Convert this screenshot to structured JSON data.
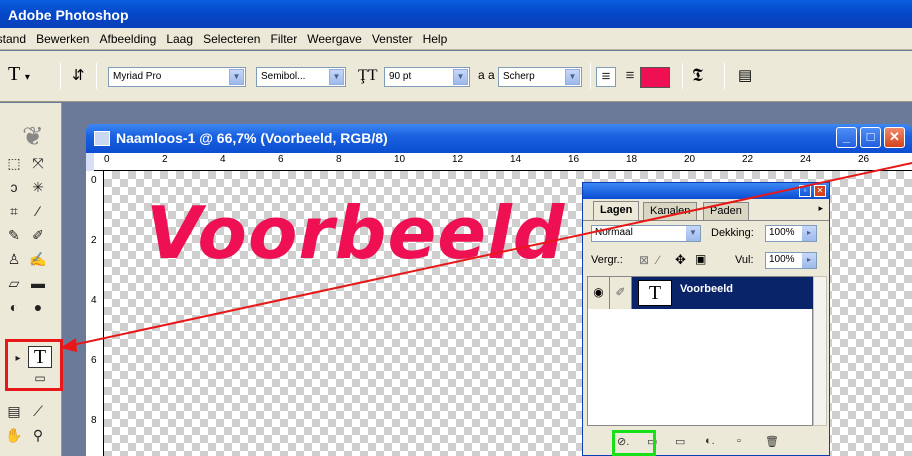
{
  "app": {
    "title": "Adobe Photoshop"
  },
  "menu": [
    "Bestand",
    "Bewerken",
    "Afbeelding",
    "Laag",
    "Selecteren",
    "Filter",
    "Weergave",
    "Venster",
    "Help"
  ],
  "options": {
    "tool_glyph": "T",
    "font_family": "Myriad Pro",
    "font_style": "Semibol...",
    "font_size": "90 pt",
    "aa_label": "a a",
    "antialias": "Scherp",
    "color": "#ee1053"
  },
  "document": {
    "title": "Naamloos-1 @ 66,7% (Voorbeeld, RGB/8)",
    "canvas_text": "Voorbeeld",
    "ruler_top": [
      "0",
      "2",
      "4",
      "6",
      "8",
      "10",
      "12",
      "14",
      "16",
      "18",
      "20",
      "22",
      "24",
      "26"
    ],
    "ruler_left": [
      "0",
      "2",
      "4",
      "6",
      "8"
    ]
  },
  "layers_panel": {
    "tabs": [
      "Lagen",
      "Kanalen",
      "Paden"
    ],
    "blend_mode": "Normaal",
    "opacity_label": "Dekking:",
    "opacity_value": "100%",
    "lock_label": "Vergr.:",
    "fill_label": "Vul:",
    "fill_value": "100%",
    "layer_name": "Voorbeeld",
    "layer_thumb": "T"
  },
  "highlights": {
    "type_tool_color": "#e81818",
    "fx_button_color": "#18e018",
    "arrow_color": "#e81818"
  }
}
